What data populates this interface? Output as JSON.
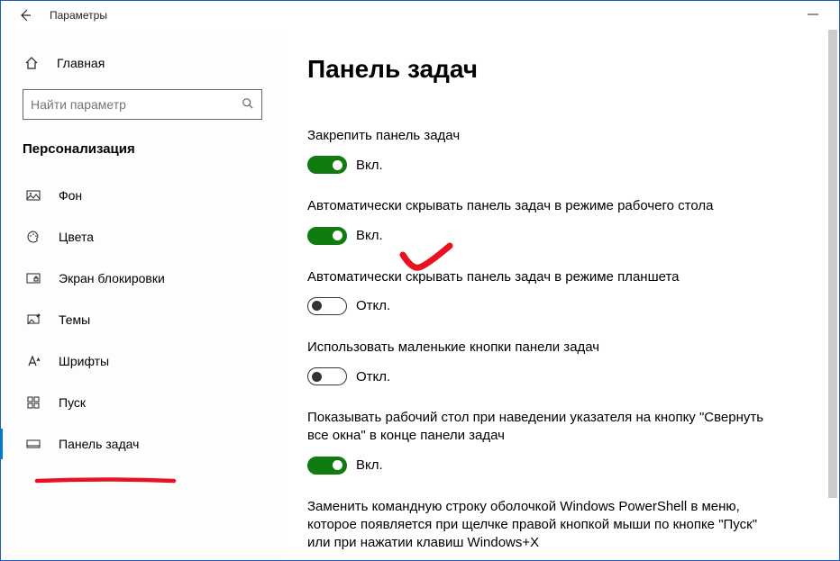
{
  "window": {
    "title": "Параметры"
  },
  "sidebar": {
    "home": "Главная",
    "search_placeholder": "Найти параметр",
    "category": "Персонализация",
    "items": [
      {
        "label": "Фон"
      },
      {
        "label": "Цвета"
      },
      {
        "label": "Экран блокировки"
      },
      {
        "label": "Темы"
      },
      {
        "label": "Шрифты"
      },
      {
        "label": "Пуск"
      },
      {
        "label": "Панель задач"
      }
    ]
  },
  "main": {
    "heading": "Панель задач",
    "settings": [
      {
        "label": "Закрепить панель задач",
        "on": true,
        "state": "Вкл."
      },
      {
        "label": "Автоматически скрывать панель задач в режиме рабочего стола",
        "on": true,
        "state": "Вкл."
      },
      {
        "label": "Автоматически скрывать панель задач в режиме планшета",
        "on": false,
        "state": "Откл."
      },
      {
        "label": "Использовать маленькие кнопки панели задач",
        "on": false,
        "state": "Откл."
      },
      {
        "label": "Показывать рабочий стол при наведении указателя на кнопку \"Свернуть все окна\" в конце панели задач",
        "on": true,
        "state": "Вкл."
      },
      {
        "label": "Заменить командную строку оболочкой Windows PowerShell в меню, которое появляется при щелчке правой кнопкой мыши по кнопке \"Пуск\" или при нажатии клавиш Windows+X"
      }
    ]
  }
}
